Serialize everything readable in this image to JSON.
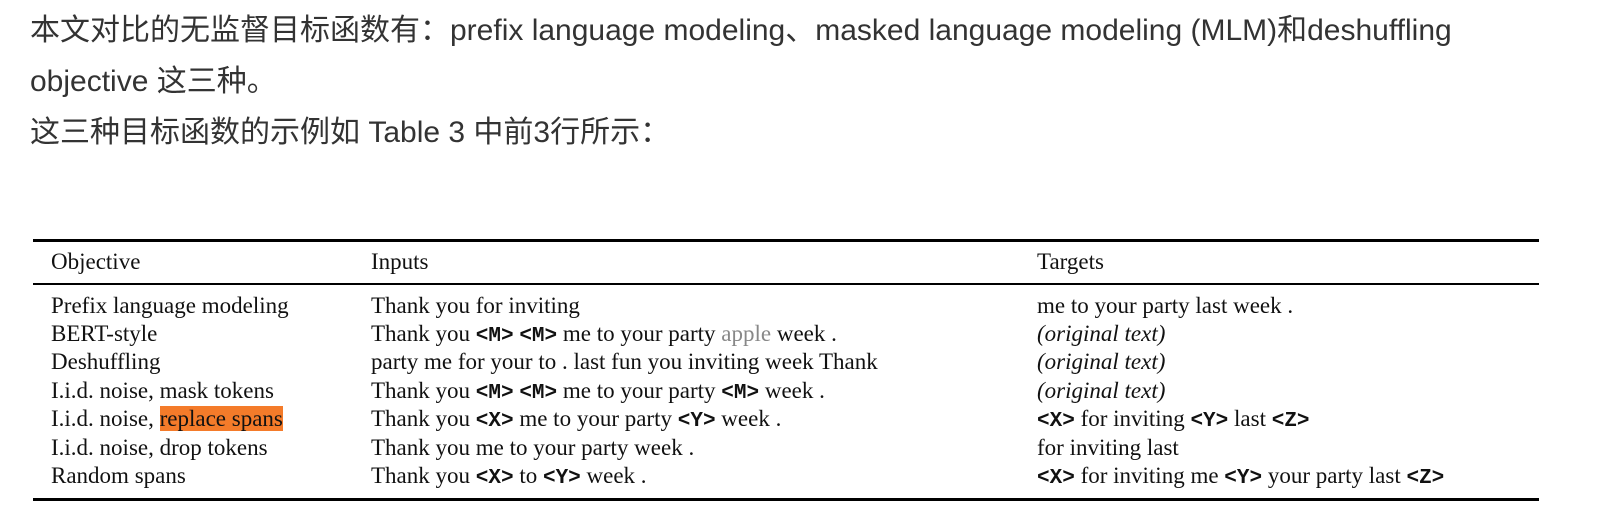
{
  "intro": {
    "line1": "本文对比的无监督目标函数有：prefix language modeling、masked language modeling (MLM)和deshuffling",
    "line2": "objective 这三种。",
    "line3": "这三种目标函数的示例如 Table 3 中前3行所示："
  },
  "table": {
    "headers": {
      "objective": "Objective",
      "inputs": "Inputs",
      "targets": "Targets"
    },
    "rows": [
      {
        "objective": "Prefix language modeling",
        "input": "Thank you for inviting",
        "target": "me to your party last week ."
      },
      {
        "objective": "BERT-style",
        "input": {
          "p1": "Thank you ",
          "m1": "<M>",
          "p2": " ",
          "m2": "<M>",
          "p3": " me to your party ",
          "apple": "apple",
          "p4": " week ."
        },
        "target": "(original text)"
      },
      {
        "objective": "Deshuffling",
        "input": "party me for your to . last fun you inviting week Thank",
        "target": "(original text)"
      },
      {
        "objective": "I.i.d. noise, mask tokens",
        "input": {
          "p1": "Thank you ",
          "m1": "<M>",
          "p2": " ",
          "m2": "<M>",
          "p3": " me to your party ",
          "m3": "<M>",
          "p4": " week ."
        },
        "target": "(original text)"
      },
      {
        "objective": {
          "prefix": "I.i.d. noise, ",
          "highlight": "replace spans"
        },
        "input": {
          "p1": "Thank you ",
          "x": "<X>",
          "p2": " me to your party ",
          "y": "<Y>",
          "p3": " week ."
        },
        "target": {
          "x": "<X>",
          "p1": " for inviting ",
          "y": "<Y>",
          "p2": " last ",
          "z": "<Z>"
        }
      },
      {
        "objective": "I.i.d. noise, drop tokens",
        "input": "Thank you me to your party week .",
        "target": "for inviting last"
      },
      {
        "objective": "Random spans",
        "input": {
          "p1": "Thank you ",
          "x": "<X>",
          "p2": " to ",
          "y": "<Y>",
          "p3": " week ."
        },
        "target": {
          "x": "<X>",
          "p1": " for inviting me ",
          "y": "<Y>",
          "p2": " your party last ",
          "z": "<Z>"
        }
      }
    ]
  },
  "colors": {
    "highlight": "#f47b2a",
    "muted_word": "#888888"
  }
}
